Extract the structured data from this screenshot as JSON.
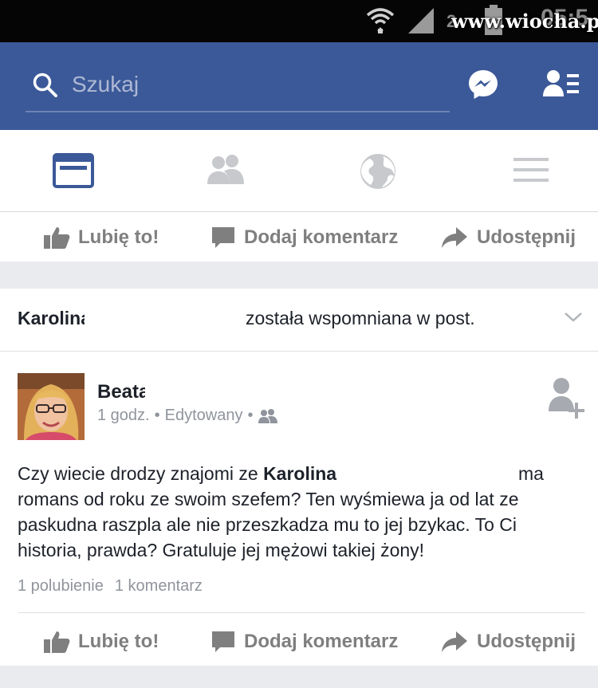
{
  "statusbar": {
    "carrier": "2",
    "clock": "05:5",
    "watermark": "www.wiocha.pl"
  },
  "header": {
    "search": {
      "placeholder": "Szukaj"
    },
    "icons": [
      "search-icon",
      "messenger-icon",
      "friend-requests-icon"
    ],
    "bar_color": "#3b5998"
  },
  "tabs": [
    {
      "name": "news-feed",
      "icon": "news-feed-icon",
      "active": true
    },
    {
      "name": "friends",
      "icon": "friends-icon",
      "active": false
    },
    {
      "name": "notifications",
      "icon": "globe-icon",
      "active": false
    },
    {
      "name": "menu",
      "icon": "hamburger-menu-icon",
      "active": false
    }
  ],
  "actions_top": {
    "like": "Lubię to!",
    "comment": "Dodaj komentarz",
    "share": "Udostępnij"
  },
  "notification": {
    "name": "Karolina",
    "text": "została wspomniana w post."
  },
  "post": {
    "author": "Beata",
    "time": "1 godz.",
    "edited": "Edytowany",
    "separator": "•",
    "body": {
      "l1_prefix": "Czy wiecie drodzy znajomi ze ",
      "l1_name": "Karolina",
      "l1_suffix": "ma",
      "l2": "romans od roku ze swoim szefem? Ten wyśmiewa ja od lat ze",
      "l3": "paskudna raszpla ale nie przeszkadza mu to jej bzykac. To Ci",
      "l4": "historia, prawda? Gratuluje jej mężowi takiej żony!"
    },
    "likes": "1 polubienie",
    "comments": "1 komentarz"
  },
  "actions_bottom": {
    "like": "Lubię to!",
    "comment": "Dodaj komentarz",
    "share": "Udostępnij"
  }
}
